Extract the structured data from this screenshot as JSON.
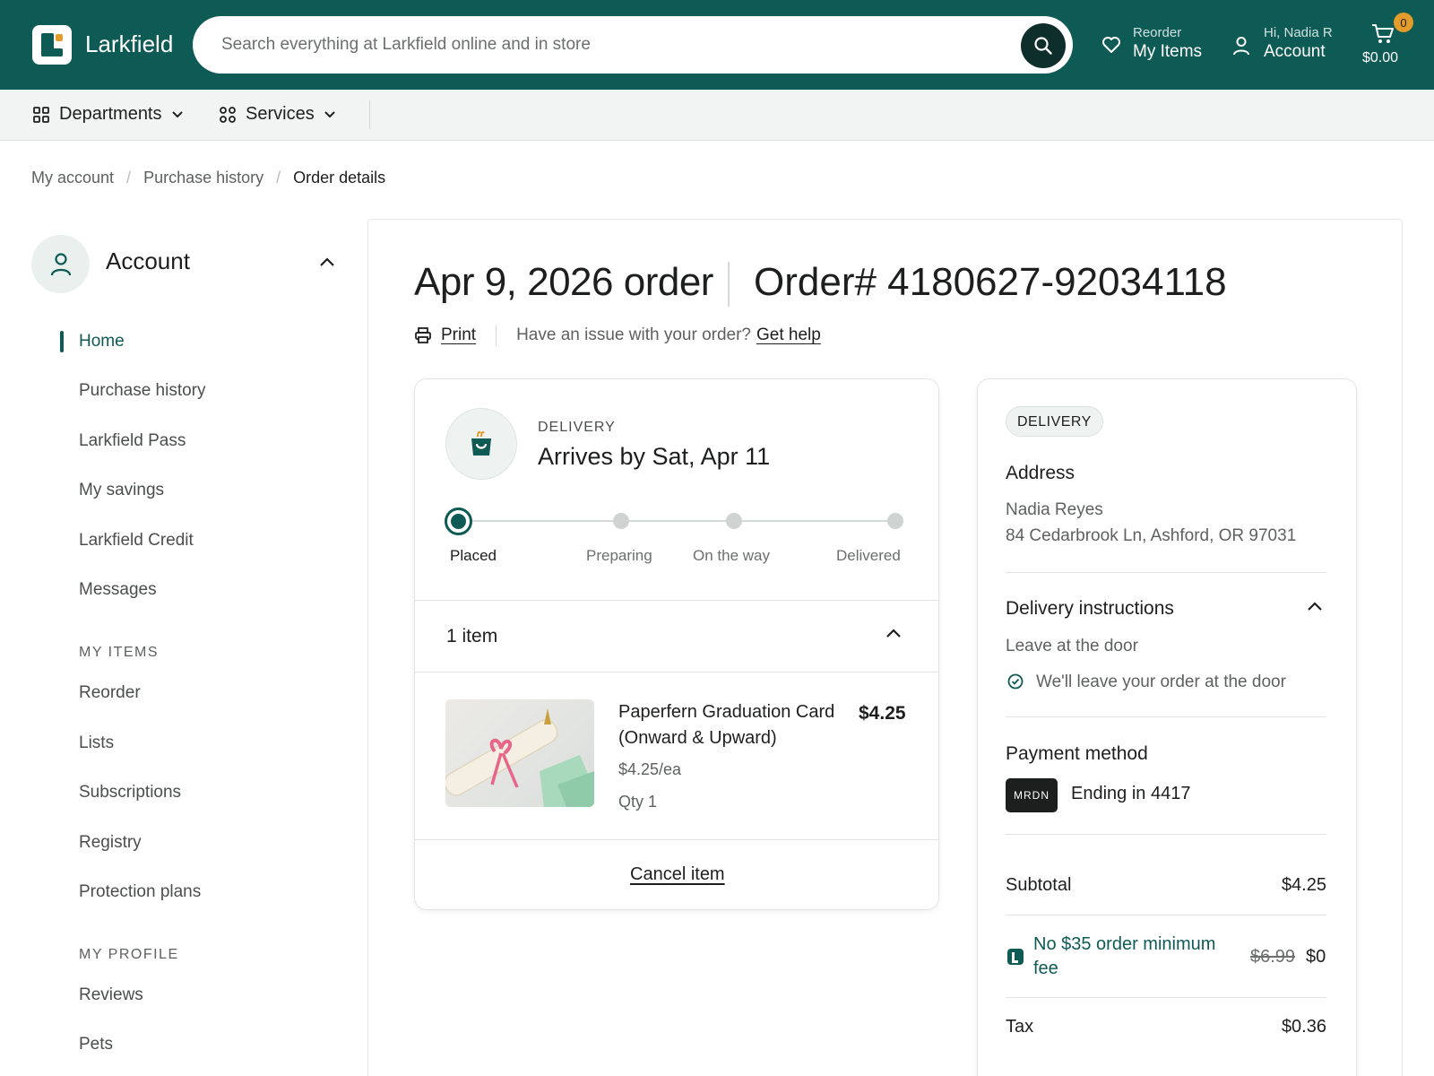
{
  "header": {
    "brand": "Larkfield",
    "search_placeholder": "Search everything at Larkfield online and in store",
    "reorder_small": "Reorder",
    "reorder_big": "My Items",
    "account_small": "Hi, Nadia R",
    "account_big": "Account",
    "cart_count": "0",
    "cart_amount": "$0.00"
  },
  "subnav": {
    "departments": "Departments",
    "services": "Services"
  },
  "breadcrumb": [
    "My account",
    "Purchase history",
    "Order details"
  ],
  "sidebar": {
    "title": "Account",
    "links": [
      "Home",
      "Purchase history",
      "Larkfield Pass",
      "My savings",
      "Larkfield Credit",
      "Messages"
    ],
    "my_items_heading": "MY ITEMS",
    "my_items": [
      "Reorder",
      "Lists",
      "Subscriptions",
      "Registry",
      "Protection plans"
    ],
    "my_profile_heading": "MY PROFILE",
    "my_profile": [
      "Reviews",
      "Pets"
    ]
  },
  "order": {
    "title": "Apr 9, 2026 order",
    "number": "Order# 4180627-92034118",
    "print": "Print",
    "issue_text": "Have an issue with your order?",
    "get_help": "Get help"
  },
  "delivery": {
    "label": "DELIVERY",
    "arrives": "Arrives by Sat, Apr 11",
    "steps": [
      "Placed",
      "Preparing",
      "On the way",
      "Delivered"
    ],
    "current_step": 0,
    "items_count": "1 item",
    "item": {
      "name": "Paperfern Graduation Card (Onward & Upward)",
      "price": "$4.25",
      "unit_price": "$4.25/ea",
      "qty": "Qty 1"
    },
    "cancel": "Cancel item"
  },
  "summary": {
    "pill": "DELIVERY",
    "address_heading": "Address",
    "address_name": "Nadia Reyes",
    "address_line": "84 Cedarbrook Ln, Ashford, OR 97031",
    "instructions_heading": "Delivery instructions",
    "instructions_text": "Leave at the door",
    "instructions_note": "We'll leave your order at the door",
    "payment_heading": "Payment method",
    "card_brand": "MRDN",
    "card_ending": "Ending in 4417",
    "subtotal_label": "Subtotal",
    "subtotal_value": "$4.25",
    "promo_label": "No $35 order minimum fee",
    "promo_old": "$6.99",
    "promo_new": "$0",
    "tax_label": "Tax",
    "tax_value": "$0.36"
  },
  "colors": {
    "brand": "#0e5a55",
    "accent": "#e39b2a"
  }
}
